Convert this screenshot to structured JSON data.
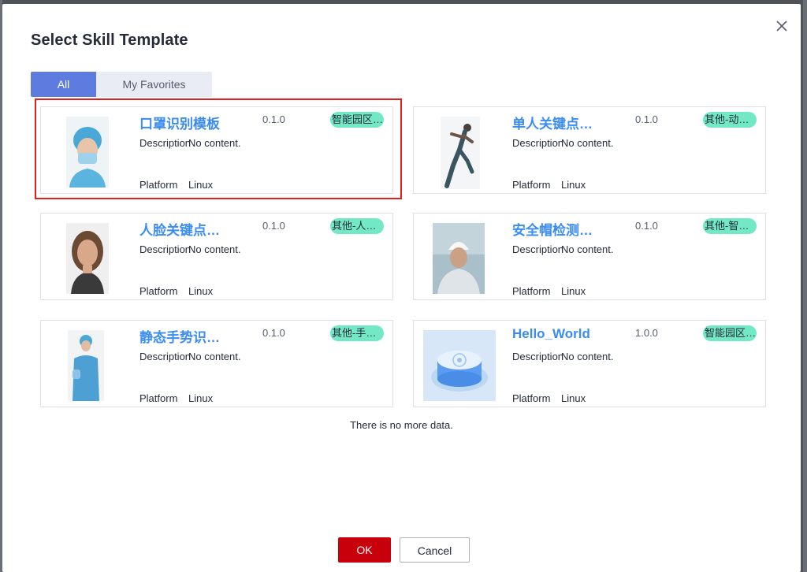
{
  "dialog": {
    "title": "Select Skill Template",
    "tabs": [
      {
        "label": "All",
        "active": true
      },
      {
        "label": "My Favorites",
        "active": false
      }
    ],
    "cards": [
      {
        "name": "口罩识别模板",
        "version": "0.1.0",
        "tag": "智能园区…",
        "desc_label": "Description",
        "desc_value": "No content.",
        "platform_label": "Platform",
        "platform_value": "Linux",
        "image": "nurse-with-mask-photo"
      },
      {
        "name": "单人关键点…",
        "version": "0.1.0",
        "tag": "其他-动…",
        "desc_label": "Description",
        "desc_value": "No content.",
        "platform_label": "Platform",
        "platform_value": "Linux",
        "image": "runner-photo"
      },
      {
        "name": "人脸关键点…",
        "version": "0.1.0",
        "tag": "其他-人…",
        "desc_label": "Description",
        "desc_value": "No content.",
        "platform_label": "Platform",
        "platform_value": "Linux",
        "image": "woman-face-photo"
      },
      {
        "name": "安全帽检测…",
        "version": "0.1.0",
        "tag": "其他-智…",
        "desc_label": "Description",
        "desc_value": "No content.",
        "platform_label": "Platform",
        "platform_value": "Linux",
        "image": "worker-helmet-photo"
      },
      {
        "name": "静态手势识…",
        "version": "0.1.0",
        "tag": "其他-手…",
        "desc_label": "Description",
        "desc_value": "No content.",
        "platform_label": "Platform",
        "platform_value": "Linux",
        "image": "medic-thumbs-up-photo"
      },
      {
        "name": "Hello_World",
        "version": "1.0.0",
        "tag": "智能园区…",
        "desc_label": "Description",
        "desc_value": "No content.",
        "platform_label": "Platform",
        "platform_value": "Linux",
        "image": "device-render"
      }
    ],
    "no_more_text": "There is no more data.",
    "ok_label": "OK",
    "cancel_label": "Cancel"
  },
  "colors": {
    "accent": "#5e7ce0",
    "link": "#3a8cf3",
    "tag": "#73e8c4",
    "primary_button": "#c7000b",
    "highlight": "#e02020"
  },
  "icons": {
    "close": "close-icon"
  }
}
